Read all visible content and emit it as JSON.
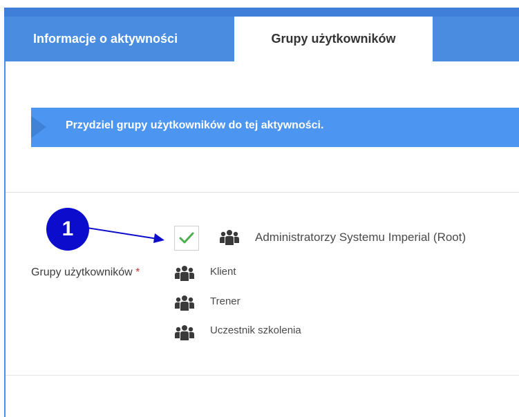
{
  "tabs": [
    {
      "label": "Informacje o aktywności",
      "active": false
    },
    {
      "label": "Grupy użytkowników",
      "active": true
    }
  ],
  "banner": {
    "text": "Przydziel grupy użytkowników do tej aktywności."
  },
  "field": {
    "label": "Grupy użytkowników",
    "required_mark": "*"
  },
  "annotation": {
    "number": "1"
  },
  "groups": [
    {
      "label": "Administratorzy Systemu Imperial (Root)",
      "checked": true,
      "icon": "users-group-icon"
    },
    {
      "label": "Klient",
      "icon": "users-group-icon"
    },
    {
      "label": "Trener",
      "icon": "users-group-icon"
    },
    {
      "label": "Uczestnik szkolenia",
      "icon": "users-group-icon"
    }
  ],
  "colors": {
    "tab_bar": "#4a8de0",
    "banner": "#4c95f0",
    "annotation": "#0c0ccc",
    "check": "#4caf50",
    "required": "#d32f2f"
  }
}
